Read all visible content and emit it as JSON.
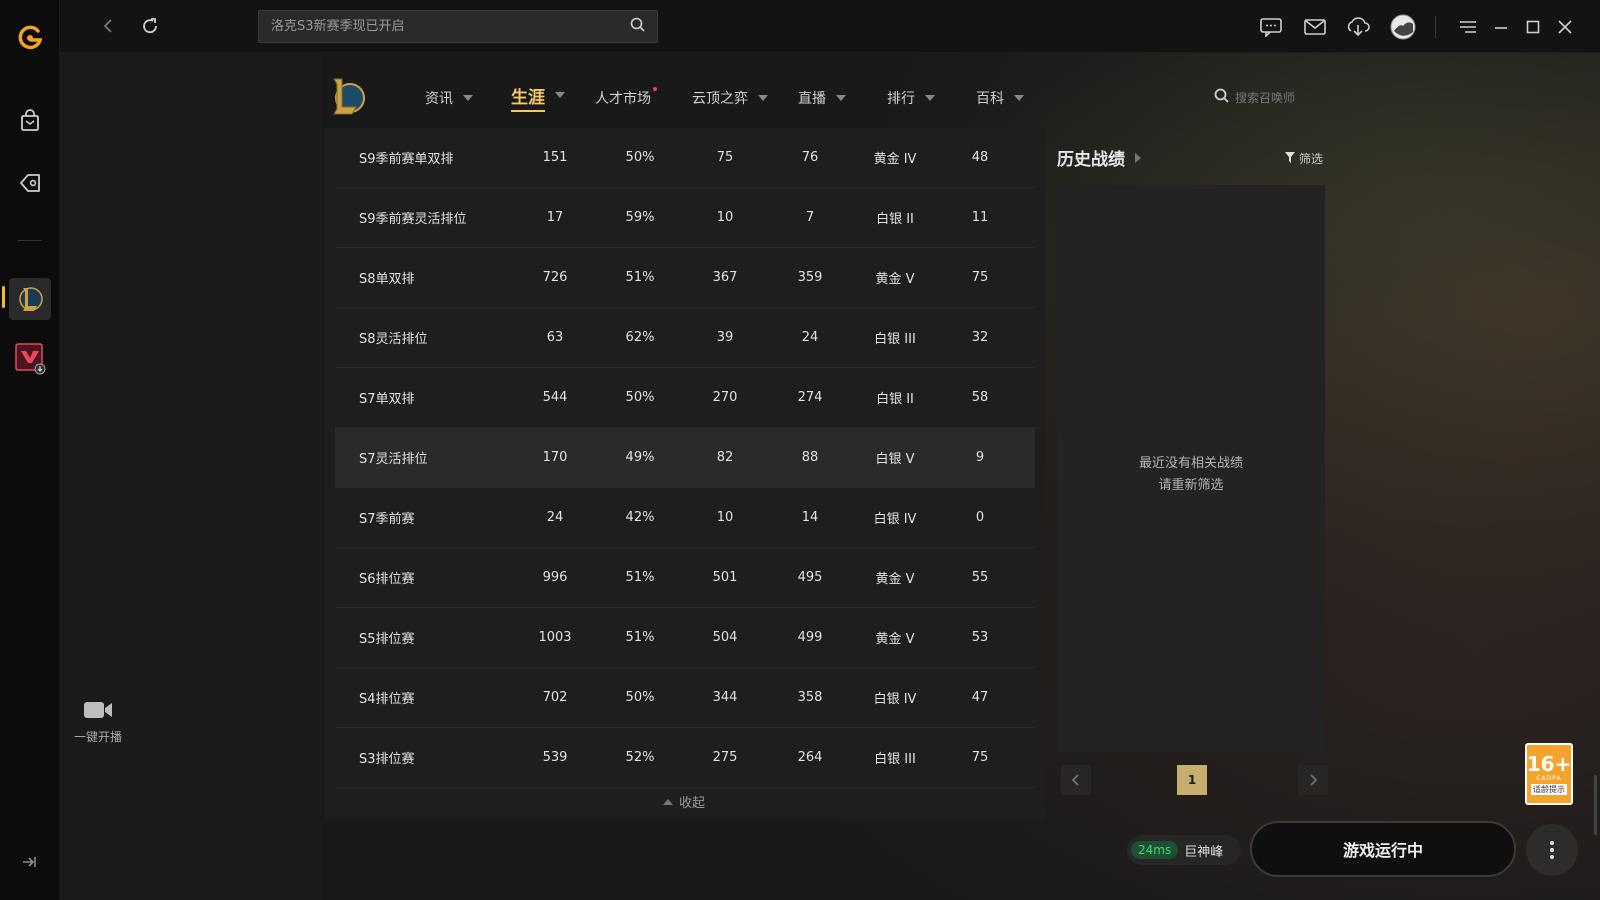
{
  "app": {
    "brand_color": "#f3b93d",
    "accent_gold": "#f3c76a"
  },
  "rail": {
    "items": [
      {
        "name": "wegame-logo-icon"
      },
      {
        "name": "shop-bag-icon"
      },
      {
        "name": "game-tag-icon"
      },
      {
        "name": "league-of-legends-icon"
      },
      {
        "name": "valorant-download-icon"
      }
    ]
  },
  "sidebar": {
    "stream_label": "一键开播"
  },
  "topbar": {
    "search_placeholder": "洛克S3新赛季现已开启"
  },
  "game_nav": {
    "items": [
      {
        "label": "资讯",
        "active": false,
        "has_caret": true
      },
      {
        "label": "生涯",
        "active": true,
        "has_caret": true
      },
      {
        "label": "人才市场",
        "active": false,
        "has_caret": false,
        "dot": true
      },
      {
        "label": "云顶之弈",
        "active": false,
        "has_caret": true
      },
      {
        "label": "直播",
        "active": false,
        "has_caret": true
      },
      {
        "label": "排行",
        "active": false,
        "has_caret": true
      },
      {
        "label": "百科",
        "active": false,
        "has_caret": true
      }
    ],
    "summoner_search_placeholder": "搜索召唤师"
  },
  "season_table": {
    "rows": [
      {
        "season": "S9季前赛单双排",
        "c1": "151",
        "winrate": "50%",
        "c3": "75",
        "c4": "76",
        "rank": "黄金 IV",
        "c6": "48"
      },
      {
        "season": "S9季前赛灵活排位",
        "c1": "17",
        "winrate": "59%",
        "c3": "10",
        "c4": "7",
        "rank": "白银 II",
        "c6": "11"
      },
      {
        "season": "S8单双排",
        "c1": "726",
        "winrate": "51%",
        "c3": "367",
        "c4": "359",
        "rank": "黄金 V",
        "c6": "75"
      },
      {
        "season": "S8灵活排位",
        "c1": "63",
        "winrate": "62%",
        "c3": "39",
        "c4": "24",
        "rank": "白银 III",
        "c6": "32"
      },
      {
        "season": "S7单双排",
        "c1": "544",
        "winrate": "50%",
        "c3": "270",
        "c4": "274",
        "rank": "白银 II",
        "c6": "58"
      },
      {
        "season": "S7灵活排位",
        "c1": "170",
        "winrate": "49%",
        "c3": "82",
        "c4": "88",
        "rank": "白银 V",
        "c6": "9"
      },
      {
        "season": "S7季前赛",
        "c1": "24",
        "winrate": "42%",
        "c3": "10",
        "c4": "14",
        "rank": "白银 IV",
        "c6": "0"
      },
      {
        "season": "S6排位赛",
        "c1": "996",
        "winrate": "51%",
        "c3": "501",
        "c4": "495",
        "rank": "黄金 V",
        "c6": "55"
      },
      {
        "season": "S5排位赛",
        "c1": "1003",
        "winrate": "51%",
        "c3": "504",
        "c4": "499",
        "rank": "黄金 V",
        "c6": "53"
      },
      {
        "season": "S4排位赛",
        "c1": "702",
        "winrate": "50%",
        "c3": "344",
        "c4": "358",
        "rank": "白银 IV",
        "c6": "47"
      },
      {
        "season": "S3排位赛",
        "c1": "539",
        "winrate": "52%",
        "c3": "275",
        "c4": "264",
        "rank": "白银 III",
        "c6": "75"
      }
    ],
    "collapse_label": "收起"
  },
  "history": {
    "title": "历史战绩",
    "filter_label": "筛选",
    "empty_line1": "最近没有相关战绩",
    "empty_line2": "请重新筛选",
    "page": "1"
  },
  "age_badge": {
    "rating": "16+",
    "org": "CADPA",
    "label": "适龄提示"
  },
  "status": {
    "ping": "24ms",
    "server": "巨神峰",
    "run_button": "游戏运行中"
  }
}
